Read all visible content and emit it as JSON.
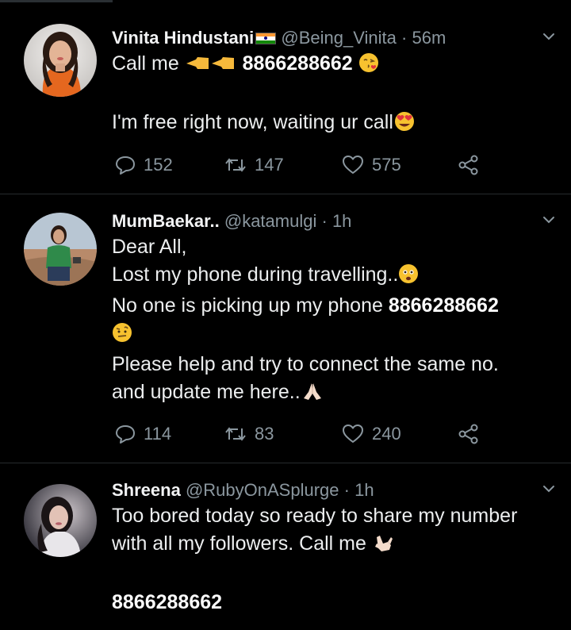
{
  "tweets": [
    {
      "name": "Vinita Hindustani",
      "handle": "@Being_Vinita",
      "time": "56m",
      "lines": [
        "Call me",
        "8866288662",
        "I'm free right now, waiting ur call"
      ],
      "counts": {
        "replies": "152",
        "retweets": "147",
        "likes": "575"
      }
    },
    {
      "name": "MumBaekar..",
      "handle": "@katamulgi",
      "time": "1h",
      "lines": [
        "Dear All,",
        "Lost my phone during travelling..",
        "No one is picking up my phone",
        "8866288662",
        "Please help and try to connect the same no.",
        "and update me here.."
      ],
      "counts": {
        "replies": "114",
        "retweets": "83",
        "likes": "240"
      }
    },
    {
      "name": "Shreena",
      "handle": "@RubyOnASplurge",
      "time": "1h",
      "lines": [
        "Too bored today so ready to share my number",
        "with all my followers. Call me",
        "8866288662"
      ]
    }
  ],
  "separator": "·",
  "icons": {
    "caret": "chevron-down-icon",
    "reply": "reply-icon",
    "retweet": "retweet-icon",
    "like": "heart-icon",
    "share": "share-icon"
  },
  "colors": {
    "background": "#000000",
    "text": "#e9ebec",
    "secondary": "#8b979f",
    "divider": "#262a2e"
  }
}
